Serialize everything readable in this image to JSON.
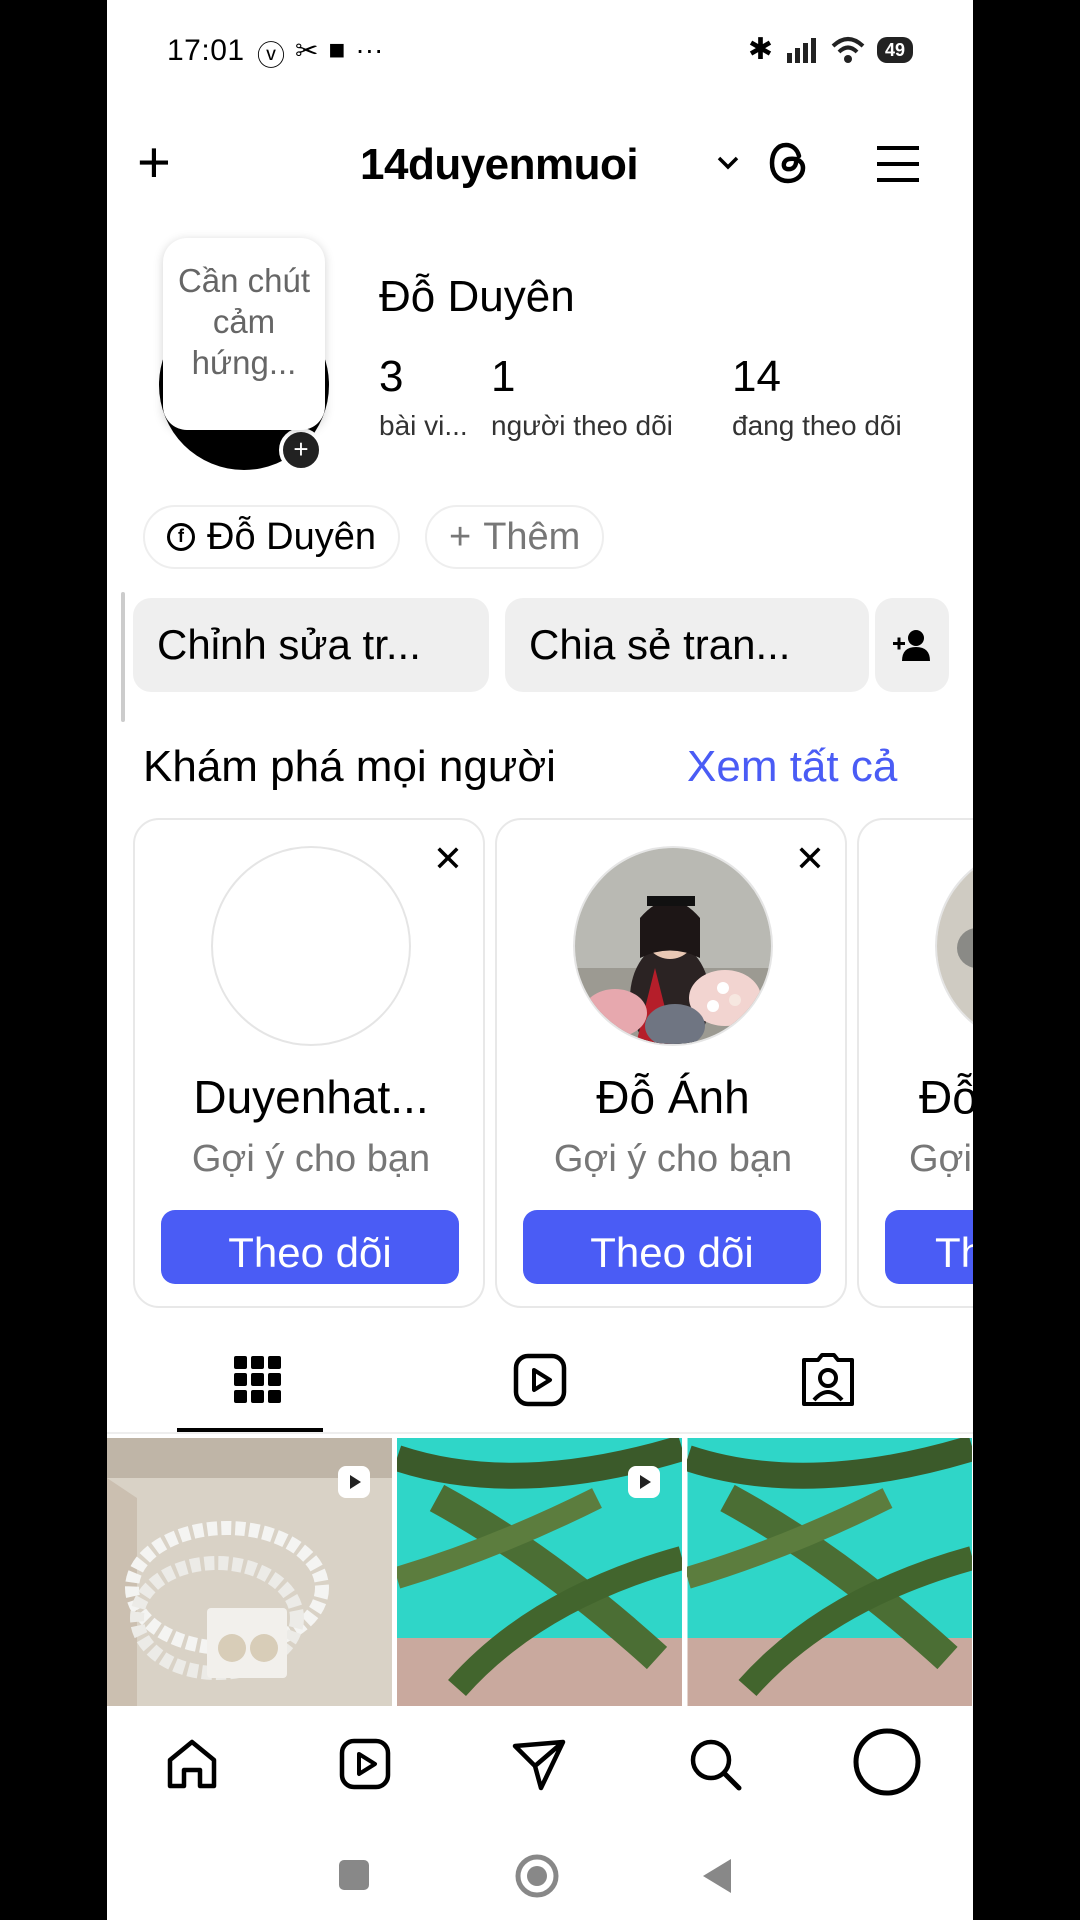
{
  "status": {
    "time": "17:01",
    "battery": "49"
  },
  "header": {
    "username": "14duyenmuoi",
    "icons": [
      "plus-icon",
      "chevron-down-icon",
      "threads-icon",
      "menu-icon"
    ]
  },
  "profile": {
    "note": "Cần chút cảm hứng...",
    "full_name": "Đỗ Duyên",
    "stats": [
      {
        "value": "3",
        "label": "bài vi..."
      },
      {
        "value": "1",
        "label": "người theo dõi"
      },
      {
        "value": "14",
        "label": "đang theo dõi"
      }
    ],
    "chips": {
      "facebook": "Đỗ Duyên",
      "add": "Thêm"
    },
    "buttons": {
      "edit": "Chỉnh sửa tr...",
      "share": "Chia sẻ tran..."
    }
  },
  "discover": {
    "title": "Khám phá mọi người",
    "see_all": "Xem tất cả",
    "cards": [
      {
        "name": "Duyenhat...",
        "subtitle": "Gợi ý cho bạn",
        "button": "Theo dõi"
      },
      {
        "name": "Đỗ Ánh",
        "subtitle": "Gợi ý cho bạn",
        "button": "Theo dõi"
      },
      {
        "name": "Đỗ",
        "subtitle": "Gợi",
        "button": "Th"
      }
    ]
  },
  "tabs": [
    "grid-icon",
    "reels-icon",
    "tagged-icon"
  ],
  "bottom_nav": [
    "home-icon",
    "reels-icon",
    "messages-icon",
    "search-icon",
    "profile-icon"
  ],
  "colors": {
    "accent": "#4a5cf5",
    "button_bg": "#efefef"
  }
}
